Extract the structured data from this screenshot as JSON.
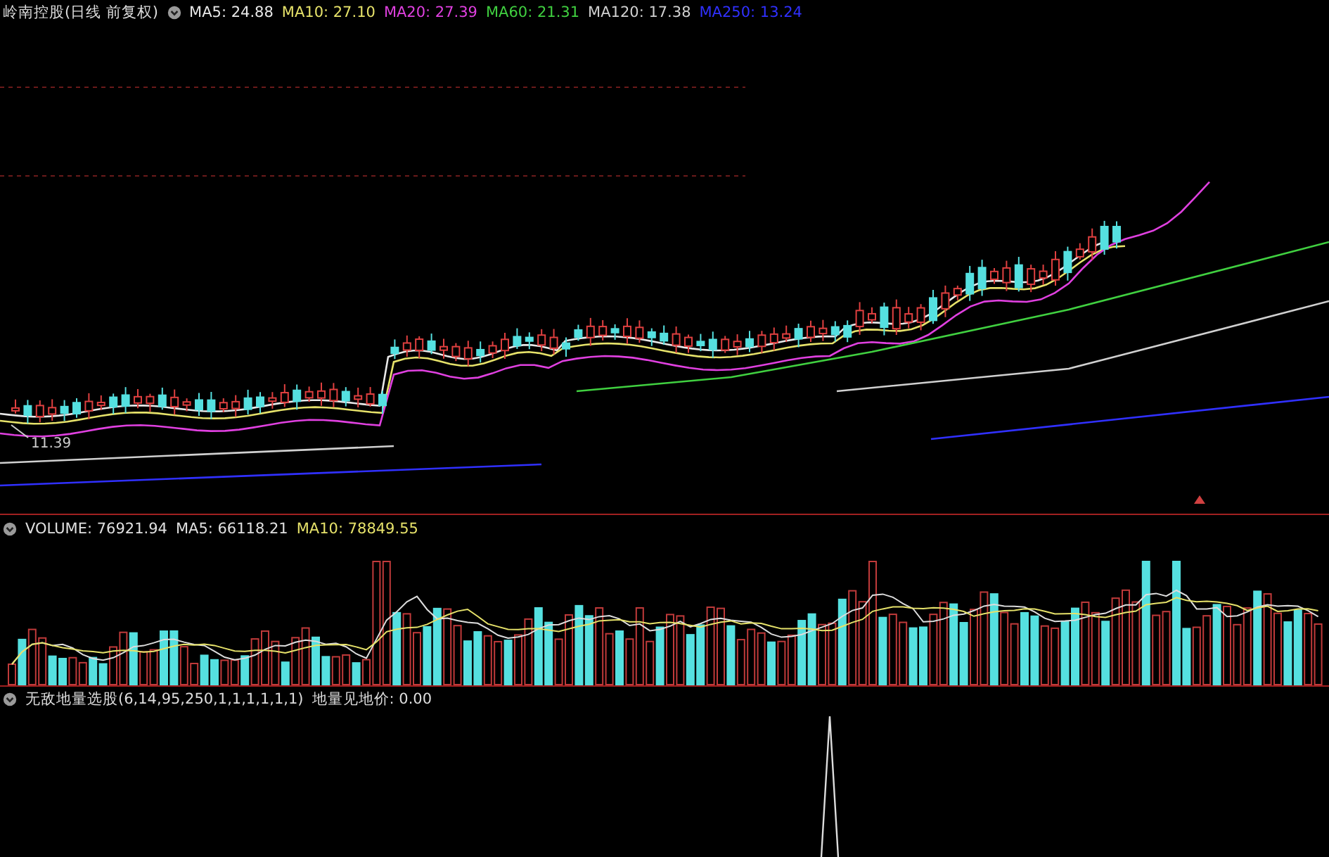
{
  "price_panel": {
    "title": "岭南控股(日线 前复权)",
    "indicators": [
      {
        "label": "MA5: 24.88",
        "color": "#e8e8e8"
      },
      {
        "label": "MA10: 27.10",
        "color": "#e6e26a"
      },
      {
        "label": "MA20: 27.39",
        "color": "#e040e0"
      },
      {
        "label": "MA60: 21.31",
        "color": "#40d040"
      },
      {
        "label": "MA120: 17.38",
        "color": "#d0d0d0"
      },
      {
        "label": "MA250: 13.24",
        "color": "#3030ff"
      }
    ],
    "low_label": "11.39"
  },
  "volume_panel": {
    "indicators": [
      {
        "label": "VOLUME: 76921.94",
        "color": "#e0e0e0"
      },
      {
        "label": "MA5: 66118.21",
        "color": "#e0e0e0"
      },
      {
        "label": "MA10: 78849.55",
        "color": "#e6e26a"
      }
    ]
  },
  "signal_panel": {
    "name": "无敌地量选股(6,14,95,250,1,1,1,1,1,1)",
    "reading": "地量见地价: 0.00"
  }
}
